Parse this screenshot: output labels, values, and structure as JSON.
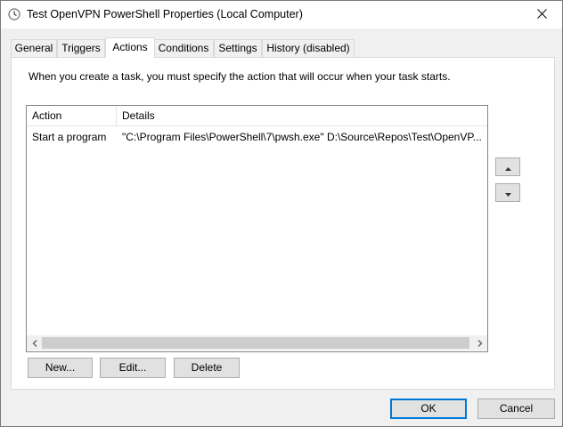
{
  "window": {
    "title": "Test OpenVPN PowerShell Properties (Local Computer)",
    "title_icon": "clock-icon",
    "close_glyph": "✕"
  },
  "tabs": [
    {
      "label": "General",
      "active": false
    },
    {
      "label": "Triggers",
      "active": false
    },
    {
      "label": "Actions",
      "active": true
    },
    {
      "label": "Conditions",
      "active": false
    },
    {
      "label": "Settings",
      "active": false
    },
    {
      "label": "History (disabled)",
      "active": false
    }
  ],
  "actions_tab": {
    "description": "When you create a task, you must specify the action that will occur when your task starts.",
    "columns": [
      "Action",
      "Details"
    ],
    "rows": [
      {
        "action": "Start a program",
        "details": "\"C:\\Program Files\\PowerShell\\7\\pwsh.exe\" D:\\Source\\Repos\\Test\\OpenVP..."
      }
    ],
    "buttons": {
      "new": "New...",
      "edit": "Edit...",
      "delete": "Delete"
    }
  },
  "footer": {
    "ok": "OK",
    "cancel": "Cancel"
  },
  "colors": {
    "accent": "#0078d7",
    "panel": "#ffffff",
    "background": "#f0f0f0"
  }
}
